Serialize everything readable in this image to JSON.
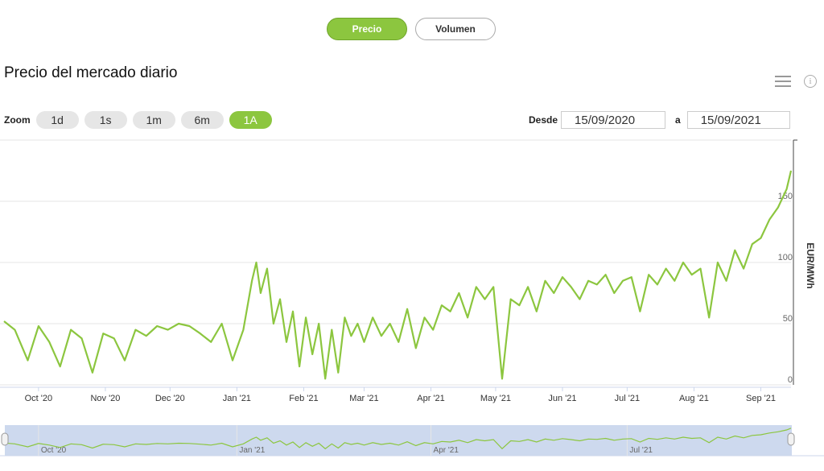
{
  "tabs": [
    {
      "label": "Precio",
      "active": true
    },
    {
      "label": "Volumen",
      "active": false
    }
  ],
  "title": "Precio del mercado diario",
  "icons": {
    "menu": "hamburger-menu-icon",
    "info": "info-icon"
  },
  "zoom": {
    "label": "Zoom",
    "buttons": [
      "1d",
      "1s",
      "1m",
      "6m",
      "1A"
    ],
    "selected": "1A"
  },
  "range": {
    "from_label": "Desde",
    "from_value": "15/09/2020",
    "to_label": "a",
    "to_value": "15/09/2021"
  },
  "colors": {
    "accent": "#8cc63f",
    "line": "#8cc63f",
    "navigator_bg": "#cdd9ee"
  },
  "chart_data": {
    "type": "line",
    "ylabel": "EUR/MWh",
    "ylim": [
      0,
      200
    ],
    "yticks": [
      0,
      50,
      100,
      150
    ],
    "xticks": [
      "Oct '20",
      "Nov '20",
      "Dec '20",
      "Jan '21",
      "Feb '21",
      "Mar '21",
      "Apr '21",
      "May '21",
      "Jun '21",
      "Jul '21",
      "Aug '21",
      "Sep '21"
    ],
    "navigator_ticks": [
      "Oct '20",
      "Jan '21",
      "Apr '21",
      "Jul '21"
    ],
    "x_start": "2020-09-15",
    "x_end": "2021-09-15",
    "series": [
      {
        "name": "",
        "x": [
          "2020-09-15",
          "2020-09-20",
          "2020-09-26",
          "2020-10-01",
          "2020-10-06",
          "2020-10-11",
          "2020-10-16",
          "2020-10-21",
          "2020-10-26",
          "2020-10-31",
          "2020-11-05",
          "2020-11-10",
          "2020-11-15",
          "2020-11-20",
          "2020-11-25",
          "2020-11-30",
          "2020-12-05",
          "2020-12-10",
          "2020-12-15",
          "2020-12-20",
          "2020-12-25",
          "2020-12-30",
          "2021-01-04",
          "2021-01-08",
          "2021-01-10",
          "2021-01-12",
          "2021-01-15",
          "2021-01-18",
          "2021-01-21",
          "2021-01-24",
          "2021-01-27",
          "2021-01-30",
          "2021-02-02",
          "2021-02-05",
          "2021-02-08",
          "2021-02-11",
          "2021-02-14",
          "2021-02-17",
          "2021-02-20",
          "2021-02-23",
          "2021-02-26",
          "2021-03-01",
          "2021-03-05",
          "2021-03-09",
          "2021-03-13",
          "2021-03-17",
          "2021-03-21",
          "2021-03-25",
          "2021-03-29",
          "2021-04-02",
          "2021-04-06",
          "2021-04-10",
          "2021-04-14",
          "2021-04-18",
          "2021-04-22",
          "2021-04-26",
          "2021-04-30",
          "2021-05-04",
          "2021-05-08",
          "2021-05-12",
          "2021-05-16",
          "2021-05-20",
          "2021-05-24",
          "2021-05-28",
          "2021-06-01",
          "2021-06-05",
          "2021-06-09",
          "2021-06-13",
          "2021-06-17",
          "2021-06-21",
          "2021-06-25",
          "2021-06-29",
          "2021-07-03",
          "2021-07-07",
          "2021-07-11",
          "2021-07-15",
          "2021-07-19",
          "2021-07-23",
          "2021-07-27",
          "2021-07-31",
          "2021-08-04",
          "2021-08-08",
          "2021-08-12",
          "2021-08-16",
          "2021-08-20",
          "2021-08-24",
          "2021-08-28",
          "2021-09-01",
          "2021-09-05",
          "2021-09-09",
          "2021-09-13",
          "2021-09-15"
        ],
        "y": [
          52,
          45,
          20,
          48,
          35,
          15,
          45,
          38,
          10,
          42,
          38,
          20,
          45,
          40,
          48,
          45,
          50,
          48,
          42,
          35,
          50,
          20,
          45,
          85,
          100,
          75,
          95,
          50,
          70,
          35,
          60,
          15,
          55,
          25,
          50,
          5,
          45,
          10,
          55,
          40,
          50,
          35,
          55,
          40,
          50,
          35,
          62,
          30,
          55,
          45,
          65,
          60,
          75,
          55,
          80,
          70,
          80,
          5,
          70,
          65,
          80,
          60,
          85,
          75,
          88,
          80,
          70,
          85,
          82,
          90,
          75,
          85,
          88,
          60,
          90,
          82,
          95,
          85,
          100,
          90,
          95,
          55,
          100,
          85,
          110,
          95,
          115,
          120,
          135,
          145,
          160,
          175
        ]
      }
    ]
  }
}
